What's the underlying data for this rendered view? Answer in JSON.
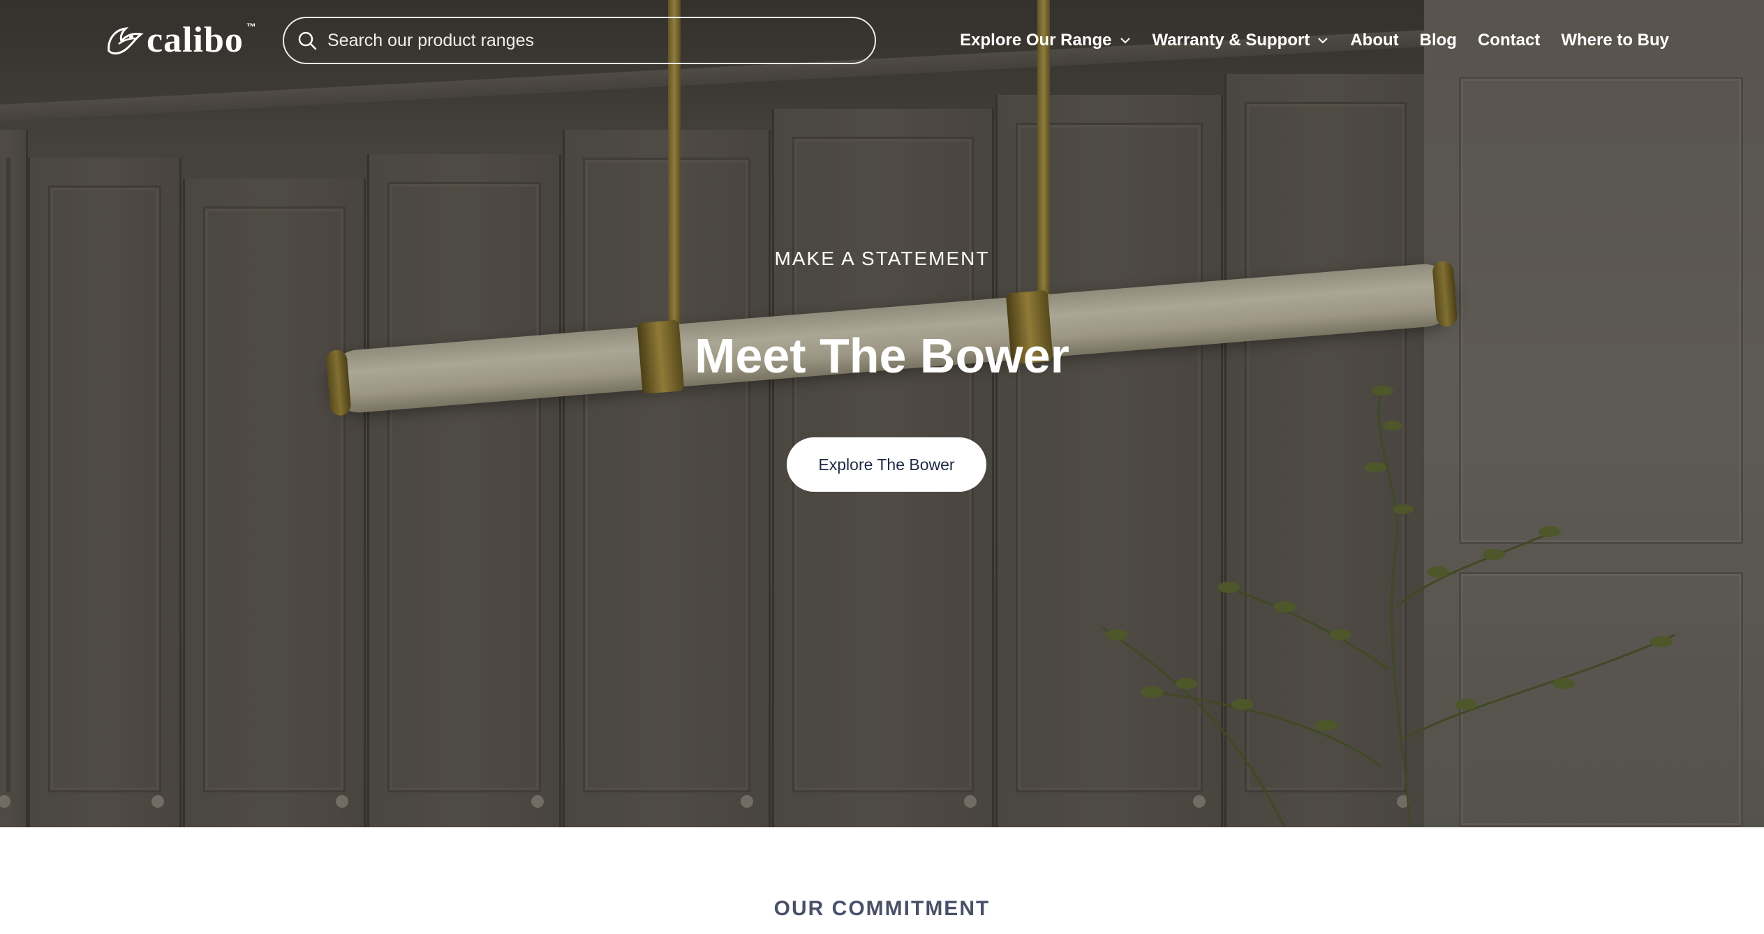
{
  "header": {
    "logo": {
      "text": "calibo",
      "trademark": "™",
      "icon": "bird-logo-icon"
    },
    "search": {
      "placeholder": "Search our product ranges",
      "value": "",
      "icon": "search-icon"
    },
    "nav": [
      {
        "label": "Explore Our Range",
        "has_dropdown": true
      },
      {
        "label": "Warranty & Support",
        "has_dropdown": true
      },
      {
        "label": "About",
        "has_dropdown": false
      },
      {
        "label": "Blog",
        "has_dropdown": false
      },
      {
        "label": "Contact",
        "has_dropdown": false
      },
      {
        "label": "Where to Buy",
        "has_dropdown": false
      }
    ]
  },
  "hero": {
    "eyebrow": "MAKE A STATEMENT",
    "title": "Meet The Bower",
    "cta_label": "Explore The Bower"
  },
  "section": {
    "heading": "OUR COMMITMENT"
  },
  "colors": {
    "header_text": "#ffffff",
    "cta_bg": "#ffffff",
    "cta_text": "#1f2a44",
    "section_heading": "#4a5068"
  }
}
